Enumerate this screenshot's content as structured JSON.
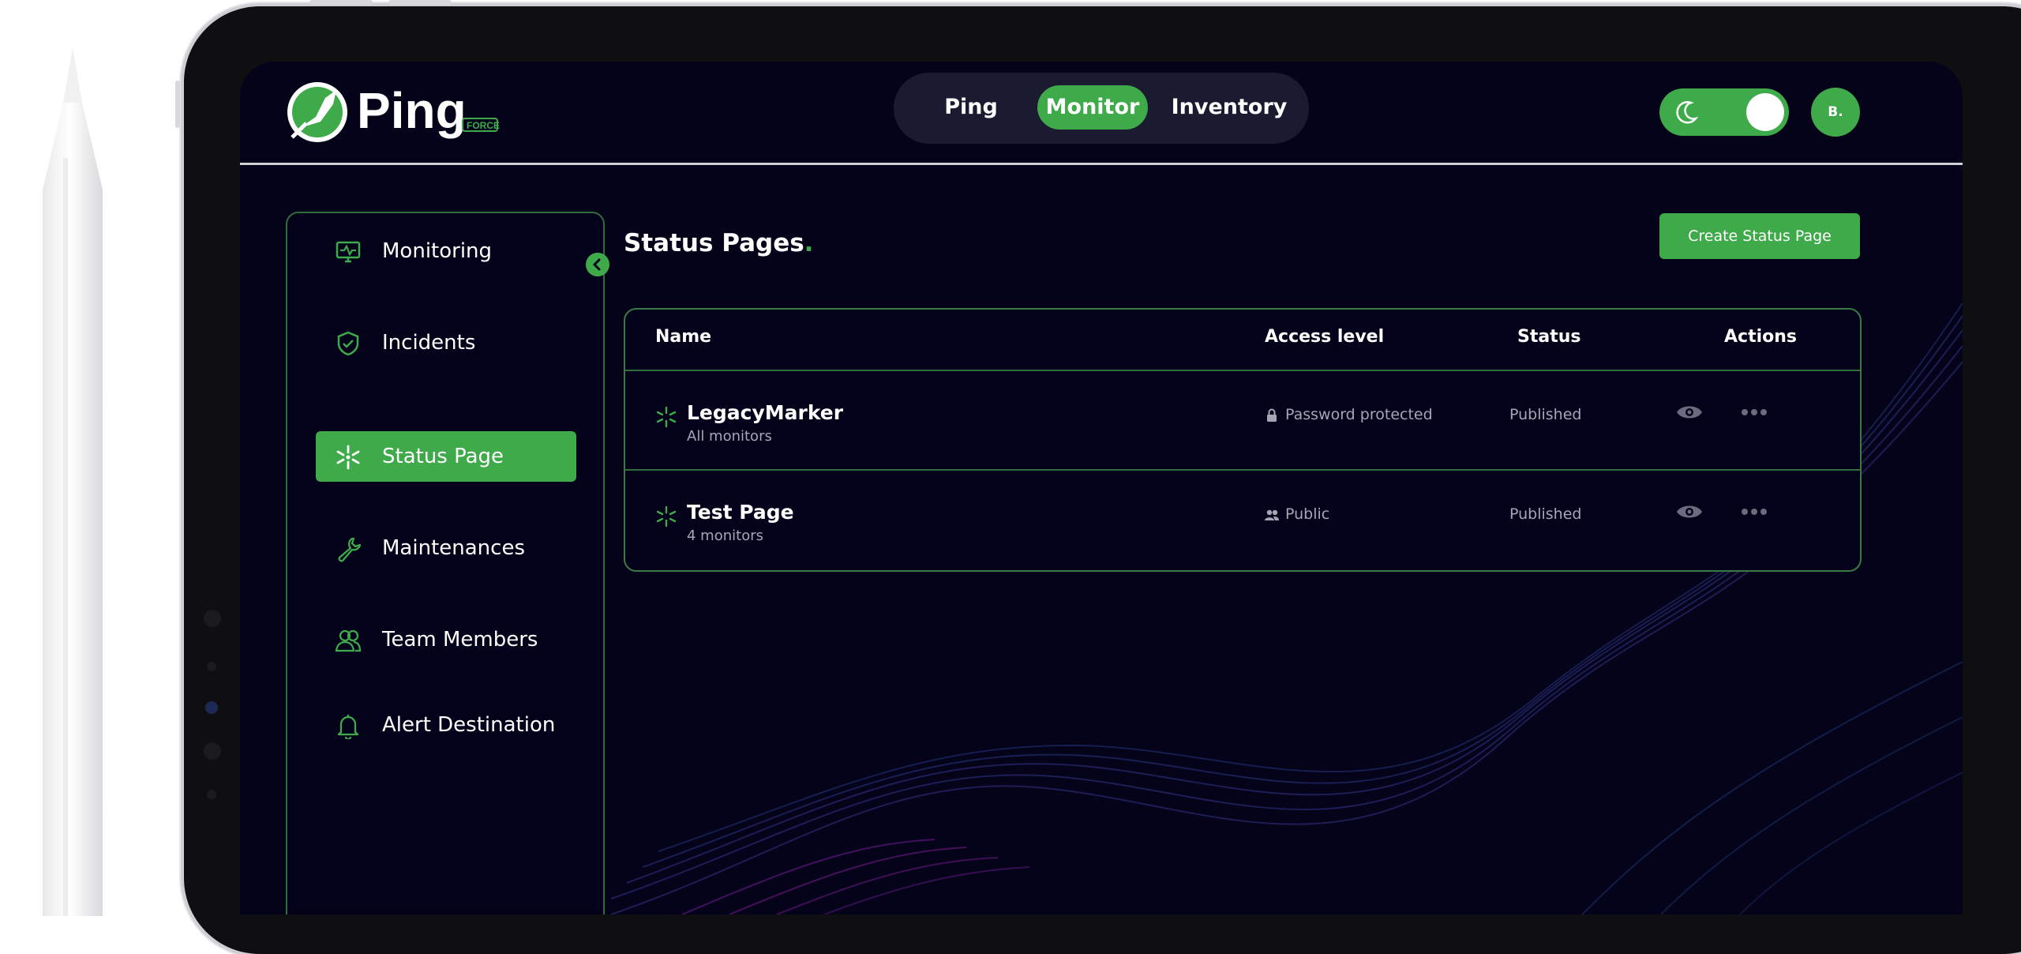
{
  "brand": {
    "name": "Ping",
    "tag": "FORCE"
  },
  "nav": {
    "items": [
      "Ping",
      "Monitor",
      "Inventory"
    ],
    "active_index": 1
  },
  "theme_toggle": {
    "icon": "moon-icon",
    "state": "on"
  },
  "user": {
    "initials": "B."
  },
  "sidebar": {
    "items": [
      {
        "label": "Monitoring",
        "icon": "monitor-icon"
      },
      {
        "label": "Incidents",
        "icon": "shield-check-icon"
      },
      {
        "label": "Status Page",
        "icon": "broadcast-icon",
        "active": true
      },
      {
        "label": "Maintenances",
        "icon": "wrench-icon"
      },
      {
        "label": "Team Members",
        "icon": "team-icon"
      },
      {
        "label": "Alert Destination",
        "icon": "bell-icon"
      }
    ]
  },
  "page": {
    "title": "Status Pages",
    "title_dot": ".",
    "create_label": "Create Status Page"
  },
  "table": {
    "columns": [
      "Name",
      "Access level",
      "Status",
      "Actions"
    ],
    "rows": [
      {
        "name": "LegacyMarker",
        "sub": "All monitors",
        "access": "Password protected",
        "access_icon": "lock-icon",
        "status": "Published"
      },
      {
        "name": "Test Page",
        "sub": "4 monitors",
        "access": "Public",
        "access_icon": "people-icon",
        "status": "Published"
      }
    ]
  },
  "colors": {
    "accent": "#3eaa4a",
    "background": "#04031a",
    "panel_border": "#2f6d3a"
  }
}
